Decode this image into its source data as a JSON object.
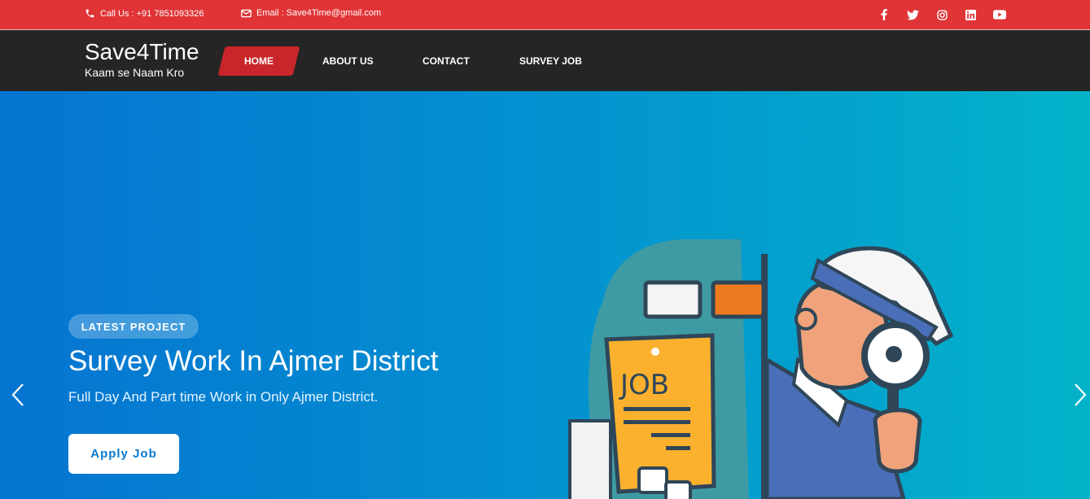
{
  "topbar": {
    "call_label": "Call Us : +91 7851093326",
    "email_label": "Email :  Save4Time@gmail.com",
    "social": [
      "facebook-icon",
      "twitter-icon",
      "instagram-icon",
      "linkedin-icon",
      "youtube-icon"
    ]
  },
  "brand": {
    "name": "Save4Time",
    "tagline": "Kaam se Naam Kro"
  },
  "nav": {
    "home": "HOME",
    "about": "ABOUT US",
    "contact": "CONTACT",
    "survey": "SURVEY JOB"
  },
  "hero": {
    "badge": "LATEST PROJECT",
    "title": "Survey Work In Ajmer District",
    "subtitle": "Full Day And Part time Work in Only Ajmer District.",
    "button": "Apply Job",
    "illustration_text": "JOB"
  },
  "colors": {
    "topbar": "#e03436",
    "navbar": "#252525",
    "active_nav": "#c8262b",
    "hero_start": "#0674d1",
    "hero_end": "#03b3c9"
  }
}
